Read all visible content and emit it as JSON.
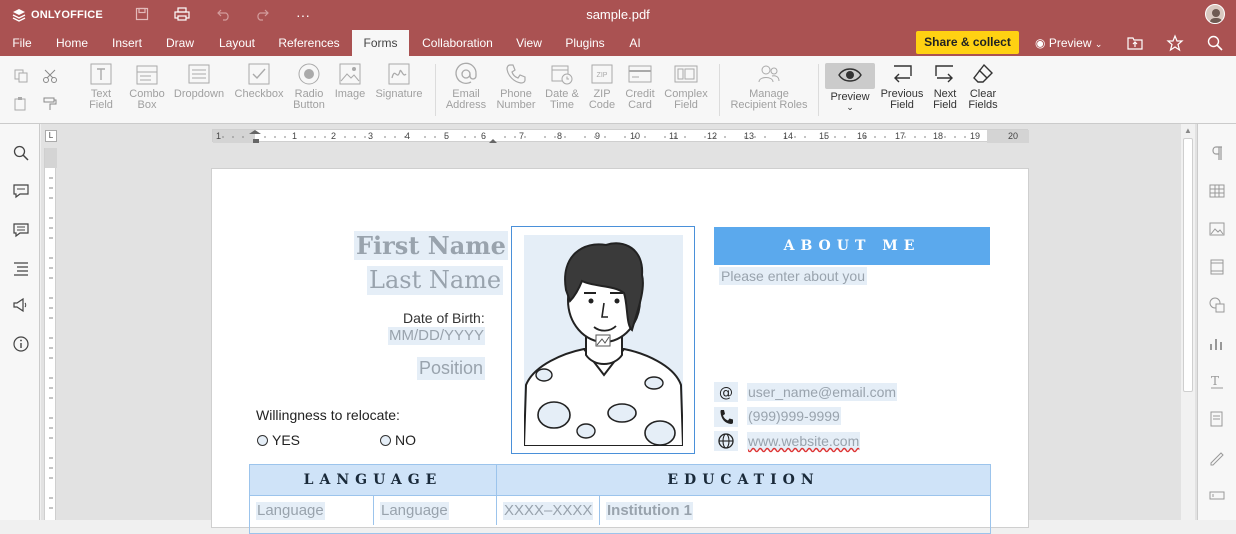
{
  "app": {
    "logo": "ONLYOFFICE",
    "document_title": "sample.pdf"
  },
  "menu": {
    "tabs": [
      "File",
      "Home",
      "Insert",
      "Draw",
      "Layout",
      "References",
      "Forms",
      "Collaboration",
      "View",
      "Plugins",
      "AI"
    ],
    "active_tab": "Forms",
    "share_button": "Share & collect",
    "preview_label": "Preview"
  },
  "toolbar": {
    "text_field": "Text\nField",
    "combo_box": "Combo\nBox",
    "dropdown": "Dropdown",
    "checkbox": "Checkbox",
    "radio_button": "Radio\nButton",
    "image": "Image",
    "signature": "Signature",
    "email_address": "Email\nAddress",
    "phone_number": "Phone\nNumber",
    "date_time": "Date &\nTime",
    "zip_code": "ZIP\nCode",
    "credit_card": "Credit\nCard",
    "complex_field": "Complex\nField",
    "manage_roles": "Manage\nRecipient Roles",
    "preview": "Preview",
    "previous_field": "Previous\nField",
    "next_field": "Next\nField",
    "clear_fields": "Clear\nFields"
  },
  "ruler": {
    "marks": [
      "1",
      "1",
      "2",
      "3",
      "4",
      "5",
      "6",
      "7",
      "8",
      "9",
      "10",
      "11",
      "12",
      "13",
      "14",
      "15",
      "16",
      "17",
      "18",
      "19",
      "20"
    ]
  },
  "form": {
    "first_name": "First Name",
    "last_name": "Last Name",
    "dob_label": "Date of Birth:",
    "dob_placeholder": "MM/DD/YYYY",
    "position": "Position",
    "relocate_label": "Willingness to relocate:",
    "yes": "YES",
    "no": "NO",
    "about_header": "ABOUT ME",
    "about_placeholder": "Please enter about you",
    "email": "user_name@email.com",
    "phone": "(999)999-9999",
    "website": "www.website.com",
    "language_header": "LANGUAGE",
    "education_header": "EDUCATION",
    "lang1": "Language",
    "lang2": "Language",
    "years": "XXXX–XXXX",
    "institution": "Institution 1"
  },
  "colors": {
    "brand": "#aa5252",
    "share": "#ffd112",
    "about_header": "#5ba9ed",
    "table_header": "#cfe3f8",
    "field_fill": "#e5eef7"
  }
}
